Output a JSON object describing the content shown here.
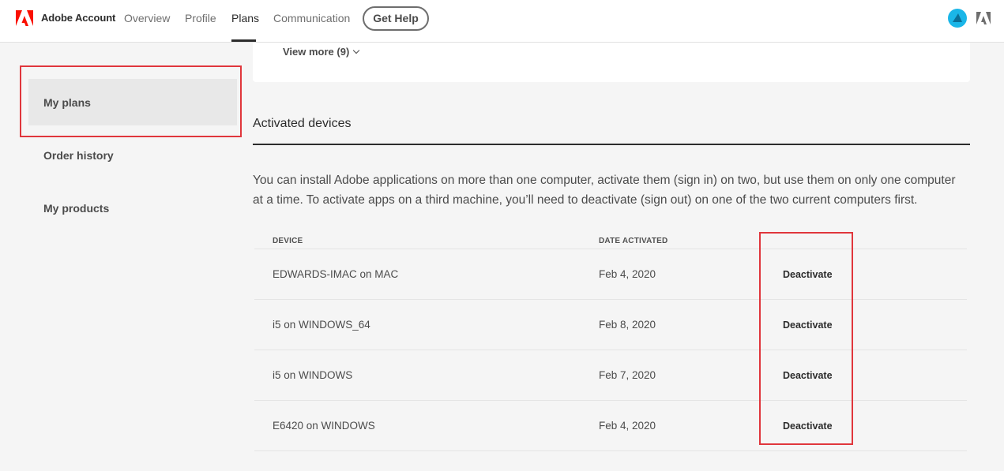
{
  "header": {
    "brand": "Adobe Account",
    "nav": [
      "Overview",
      "Profile",
      "Plans",
      "Communication"
    ],
    "active_nav": "Plans",
    "help_button": "Get Help"
  },
  "sidebar": {
    "items": [
      "My plans",
      "Order history",
      "My products"
    ],
    "active": "My plans"
  },
  "plans_card": {
    "view_more": "View more (9)"
  },
  "devices": {
    "title": "Activated devices",
    "description_line1": "You can install Adobe applications on more than one computer, activate them (sign in) on two, but use them on only one computer",
    "description_line2": "at a time. To activate apps on a third machine, you’ll need to deactivate (sign out) on one of the two current computers first.",
    "columns": [
      "DEVICE",
      "DATE ACTIVATED"
    ],
    "rows": [
      {
        "device": "EDWARDS-IMAC on MAC",
        "date": "Feb 4, 2020",
        "action": "Deactivate"
      },
      {
        "device": "i5 on WINDOWS_64",
        "date": "Feb 8, 2020",
        "action": "Deactivate"
      },
      {
        "device": "i5 on WINDOWS",
        "date": "Feb 7, 2020",
        "action": "Deactivate"
      },
      {
        "device": "E6420 on WINDOWS",
        "date": "Feb 4, 2020",
        "action": "Deactivate"
      }
    ]
  },
  "colors": {
    "adobe_red": "#fa0f00",
    "highlight_red": "#e0363c",
    "avatar_blue": "#1ab6e8"
  }
}
